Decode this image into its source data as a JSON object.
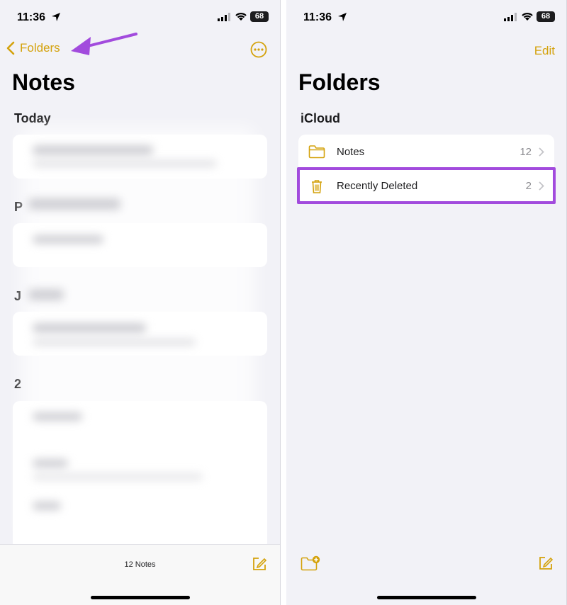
{
  "left": {
    "status": {
      "time": "11:36",
      "battery": "68"
    },
    "nav": {
      "back_label": "Folders"
    },
    "title": "Notes",
    "sections": [
      {
        "label": "Today"
      },
      {
        "label": "P"
      },
      {
        "label": "J"
      },
      {
        "label": "2"
      }
    ],
    "footer": {
      "count": "12 Notes"
    }
  },
  "right": {
    "status": {
      "time": "11:36",
      "battery": "68"
    },
    "nav": {
      "edit_label": "Edit"
    },
    "title": "Folders",
    "section": "iCloud",
    "folders": [
      {
        "name": "Notes",
        "count": "12",
        "icon": "folder-icon"
      },
      {
        "name": "Recently Deleted",
        "count": "2",
        "icon": "trash-icon"
      }
    ]
  },
  "colors": {
    "accent": "#d4a20c",
    "annotation": "#a24bdd",
    "background": "#f2f2f7"
  }
}
